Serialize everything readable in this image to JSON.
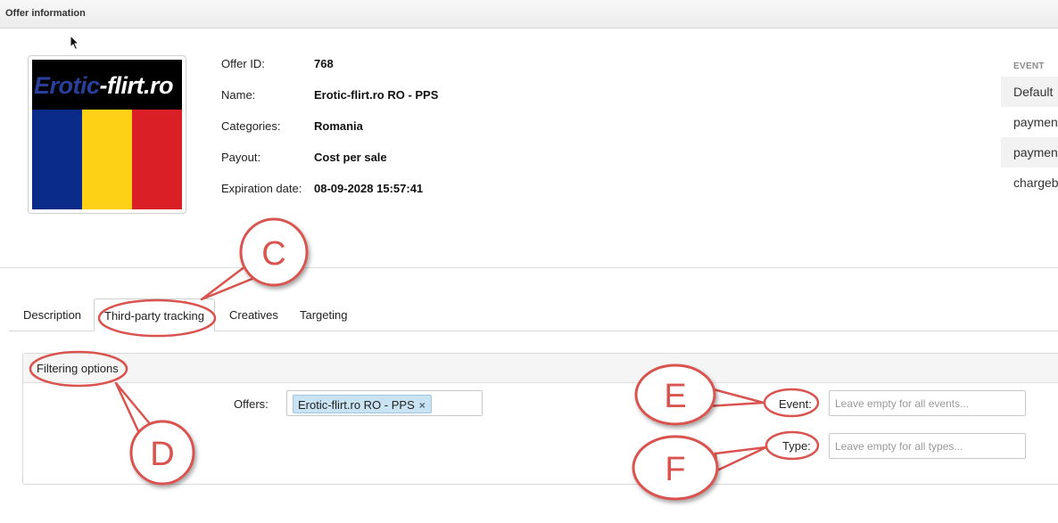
{
  "window": {
    "title": "Offer information"
  },
  "offer": {
    "logo_text_colored": "Erotic",
    "logo_text_rest": "-flirt.ro",
    "fields": [
      {
        "label": "Offer ID:",
        "value": "768"
      },
      {
        "label": "Name:",
        "value": "Erotic-flirt.ro RO - PPS"
      },
      {
        "label": "Categories:",
        "value": "Romania"
      },
      {
        "label": "Payout:",
        "value": "Cost per sale"
      },
      {
        "label": "Expiration date:",
        "value": "08-09-2028 15:57:41"
      }
    ]
  },
  "event_table": {
    "header": "EVENT",
    "rows": [
      "Default",
      "paymen",
      "paymen",
      "chargeb"
    ]
  },
  "tabs": [
    {
      "label": "Description",
      "active": false
    },
    {
      "label": "Third-party tracking",
      "active": true
    },
    {
      "label": "Creatives",
      "active": false
    },
    {
      "label": "Targeting",
      "active": false
    }
  ],
  "filter": {
    "title": "Filtering options",
    "offers_label": "Offers:",
    "offer_chip": "Erotic-flirt.ro RO - PPS",
    "chip_remove": "×",
    "event_label": "Event:",
    "event_placeholder": "Leave empty for all events...",
    "type_label": "Type:",
    "type_placeholder": "Leave empty for all types..."
  },
  "callouts": {
    "c": "C",
    "d": "D",
    "e": "E",
    "f": "F"
  },
  "colors": {
    "callout_stroke": "#d9534f",
    "callout_fill": "#ffffff",
    "chip_bg": "#c9e3f3",
    "flag_blue": "#0b2b8a",
    "flag_yellow": "#fcd116",
    "flag_red": "#da1f26"
  }
}
